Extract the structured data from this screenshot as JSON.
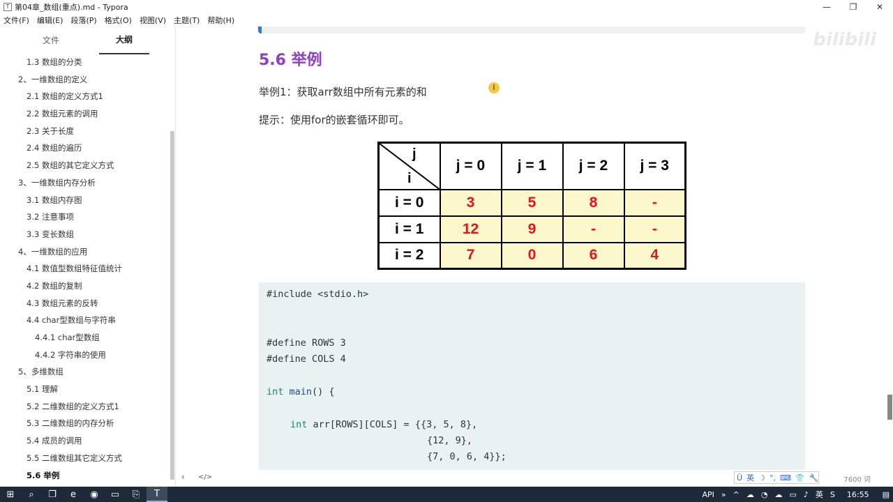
{
  "window": {
    "title": "第04章_数组(重点).md - Typora",
    "app_icon": "T",
    "minimize_icon": "—",
    "maximize_icon": "❐",
    "close_icon": "✕"
  },
  "menu": [
    "文件(F)",
    "编辑(E)",
    "段落(P)",
    "格式(O)",
    "视图(V)",
    "主题(T)",
    "帮助(H)"
  ],
  "sidebar": {
    "tabs": [
      "文件",
      "大纲"
    ],
    "items": [
      {
        "label": "1.3 数组的分类",
        "level": 2
      },
      {
        "label": "2、一维数组的定义",
        "level": 1
      },
      {
        "label": "2.1 数组的定义方式1",
        "level": 2
      },
      {
        "label": "2.2 数组元素的调用",
        "level": 2
      },
      {
        "label": "2.3 关于长度",
        "level": 2
      },
      {
        "label": "2.4 数组的遍历",
        "level": 2
      },
      {
        "label": "2.5 数组的其它定义方式",
        "level": 2
      },
      {
        "label": "3、一维数组内存分析",
        "level": 1
      },
      {
        "label": "3.1 数组内存图",
        "level": 2
      },
      {
        "label": "3.2 注意事项",
        "level": 2
      },
      {
        "label": "3.3 变长数组",
        "level": 2
      },
      {
        "label": "4、一维数组的应用",
        "level": 1
      },
      {
        "label": "4.1 数值型数组特征值统计",
        "level": 2
      },
      {
        "label": "4.2 数组的复制",
        "level": 2
      },
      {
        "label": "4.3 数组元素的反转",
        "level": 2
      },
      {
        "label": "4.4 char型数组与字符串",
        "level": 2
      },
      {
        "label": "4.4.1 char型数组",
        "level": 3
      },
      {
        "label": "4.4.2 字符串的使用",
        "level": 3
      },
      {
        "label": "5、多维数组",
        "level": 1
      },
      {
        "label": "5.1 理解",
        "level": 2
      },
      {
        "label": "5.2 二维数组的定义方式1",
        "level": 2
      },
      {
        "label": "5.3 二维数组的内存分析",
        "level": 2
      },
      {
        "label": "5.4 成员的调用",
        "level": 2
      },
      {
        "label": "5.5 二维数组其它定义方式",
        "level": 2
      },
      {
        "label": "5.6 举例",
        "level": 2,
        "active": true
      }
    ]
  },
  "content": {
    "watermark": "bilibili",
    "heading": "5.6 举例",
    "para1": "举例1：获取arr数组中所有元素的和",
    "para2": "提示：使用for的嵌套循环即可。",
    "cursor_glyph": "I",
    "table": {
      "corner_j": "j",
      "corner_i": "i",
      "col_headers": [
        "j = 0",
        "j = 1",
        "j = 2",
        "j = 3"
      ],
      "rows": [
        {
          "header": "i = 0",
          "cells": [
            "3",
            "5",
            "8",
            "-"
          ]
        },
        {
          "header": "i = 1",
          "cells": [
            "12",
            "9",
            "-",
            "-"
          ]
        },
        {
          "header": "i = 2",
          "cells": [
            "7",
            "0",
            "6",
            "4"
          ]
        }
      ]
    },
    "code": {
      "include": "#include <stdio.h>",
      "define_rows": "#define ROWS 3",
      "define_cols": "#define COLS 4",
      "main_kw": "int",
      "main_fn": "main",
      "main_rest": "() {",
      "arr_kw": "int",
      "arr_rest": " arr[ROWS][COLS] = {{3, 5, 8},",
      "arr_line2": "{12, 9},",
      "arr_line3": "{7, 0, 6, 4}};"
    }
  },
  "footer": {
    "back_icon": "‹",
    "source_icon": "</>",
    "word_count": "7600 词"
  },
  "ime": [
    "Ü",
    "英",
    "☽",
    "°,",
    "⌨",
    "👕",
    "🔧"
  ],
  "taskbar": {
    "start_icon": "⊞",
    "search_icon": "⌕",
    "taskview_icon": "❐",
    "apps": [
      "e",
      "◉",
      "▭",
      "⎘",
      "T"
    ],
    "tray": [
      "API",
      "»",
      "^",
      "☁",
      "◔",
      "☁",
      "▭",
      "♪",
      "英",
      "S"
    ],
    "time": "16:55",
    "notify_icon": "▤"
  }
}
